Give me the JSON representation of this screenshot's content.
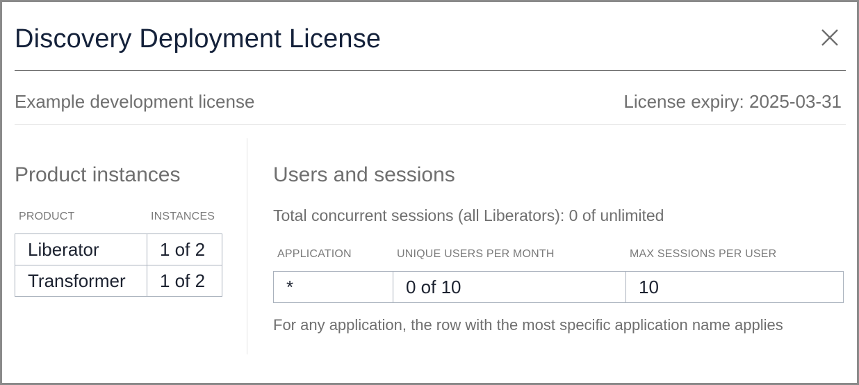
{
  "dialog": {
    "title": "Discovery Deployment License",
    "subtitle": "Example development license",
    "expiry": "License expiry: 2025-03-31"
  },
  "product_instances": {
    "heading": "Product instances",
    "columns": [
      "PRODUCT",
      "INSTANCES"
    ],
    "rows": [
      {
        "product": "Liberator",
        "instances": "1 of 2"
      },
      {
        "product": "Transformer",
        "instances": "1 of 2"
      }
    ]
  },
  "users_sessions": {
    "heading": "Users and sessions",
    "total_sessions": "Total concurrent sessions (all Liberators): 0 of unlimited",
    "columns": [
      "APPLICATION",
      "UNIQUE USERS PER MONTH",
      "MAX SESSIONS PER USER"
    ],
    "rows": [
      {
        "application": "*",
        "unique_users": "0 of 10",
        "max_sessions": "10"
      }
    ],
    "note": "For any application, the row with the most specific application name applies"
  },
  "icons": {
    "close": "close-icon"
  }
}
